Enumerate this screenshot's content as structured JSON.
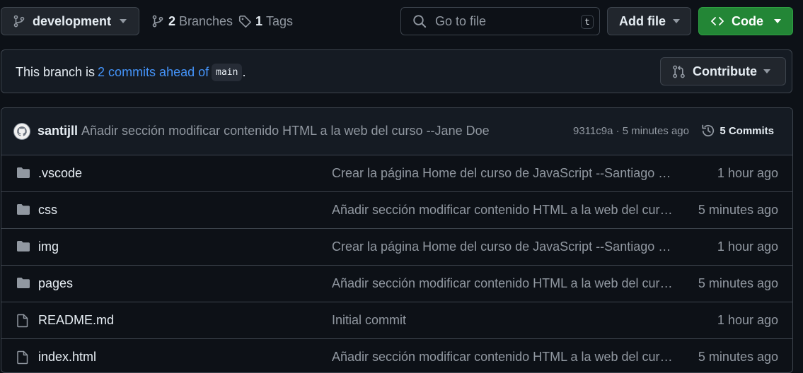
{
  "branch": {
    "name": "development"
  },
  "stats": {
    "branches_count": "2",
    "branches_label": "Branches",
    "tags_count": "1",
    "tags_label": "Tags"
  },
  "search": {
    "placeholder": "Go to file",
    "shortcut": "t"
  },
  "actions": {
    "add_file": "Add file",
    "code": "Code"
  },
  "ahead_banner": {
    "prefix": "This branch is",
    "link": "2 commits ahead of",
    "base_branch": "main",
    "suffix": ".",
    "contribute": "Contribute"
  },
  "latest_commit": {
    "author": "santijll",
    "message": "Añadir sección modificar contenido HTML a la web del curso --Jane Doe",
    "meta": "9311c9a · 5 minutes ago",
    "commits_label": "5 Commits"
  },
  "files": [
    {
      "name": ".vscode",
      "type": "folder",
      "message": "Crear la página Home del curso de JavaScript --Santiago Lo...",
      "age": "1 hour ago"
    },
    {
      "name": "css",
      "type": "folder",
      "message": "Añadir sección modificar contenido HTML a la web del curso...",
      "age": "5 minutes ago"
    },
    {
      "name": "img",
      "type": "folder",
      "message": "Crear la página Home del curso de JavaScript --Santiago Lo...",
      "age": "1 hour ago"
    },
    {
      "name": "pages",
      "type": "folder",
      "message": "Añadir sección modificar contenido HTML a la web del curso...",
      "age": "5 minutes ago"
    },
    {
      "name": "README.md",
      "type": "file",
      "message": "Initial commit",
      "age": "1 hour ago"
    },
    {
      "name": "index.html",
      "type": "file",
      "message": "Añadir sección modificar contenido HTML a la web del curso...",
      "age": "5 minutes ago"
    }
  ],
  "colors": {
    "background": "#0d1117",
    "accent_link": "#4493f8",
    "code_button": "#238636",
    "muted_text": "#9198a1"
  }
}
